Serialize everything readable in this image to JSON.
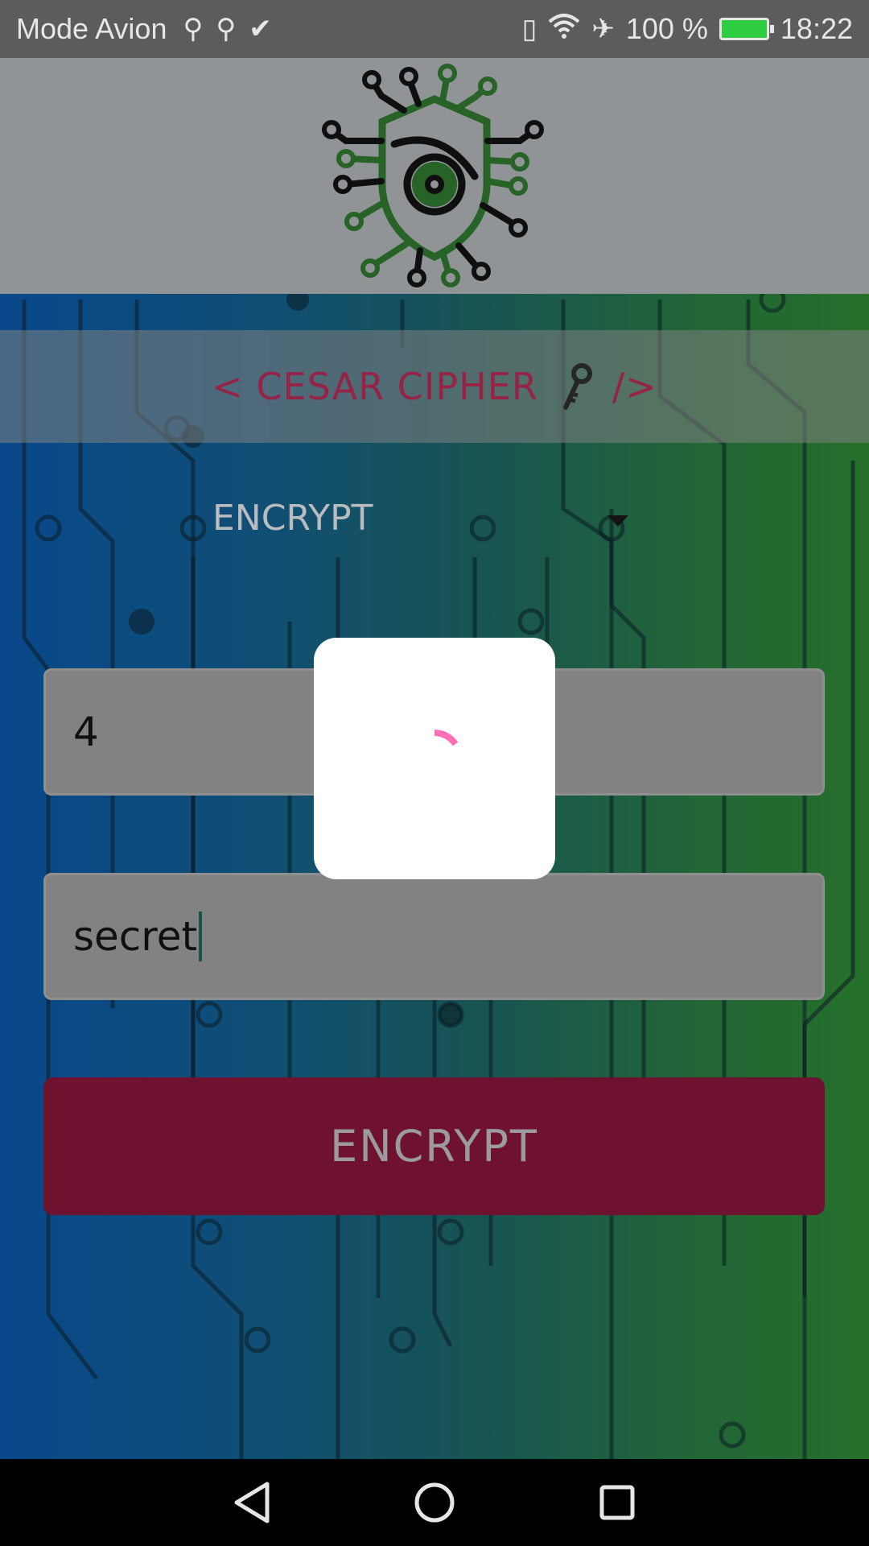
{
  "status_bar": {
    "carrier": "Mode Avion",
    "battery_percent": "100 %",
    "time": "18:22",
    "left_icons": [
      "usb-icon",
      "usb-icon",
      "download-done-icon"
    ],
    "right_icons": [
      "vibrate-icon",
      "wifi-icon",
      "airplane-icon",
      "battery-charging-icon"
    ]
  },
  "header": {
    "logo": "eye-shield-circuit-logo"
  },
  "title_band": {
    "prefix": "< CESAR CIPHER",
    "suffix": "/>",
    "icon": "key-icon"
  },
  "mode": {
    "selected": "ENCRYPT"
  },
  "form": {
    "key_value": "4",
    "text_value": "secret",
    "submit_label": "ENCRYPT"
  },
  "loading_dialog": {
    "spinner_color": "#ff6fb6"
  },
  "nav_bar": {
    "icons": [
      "back-icon",
      "home-icon",
      "recents-icon"
    ]
  },
  "colors": {
    "accent": "#791434",
    "title": "#a2264d",
    "header_bg": "#9da1a4"
  }
}
